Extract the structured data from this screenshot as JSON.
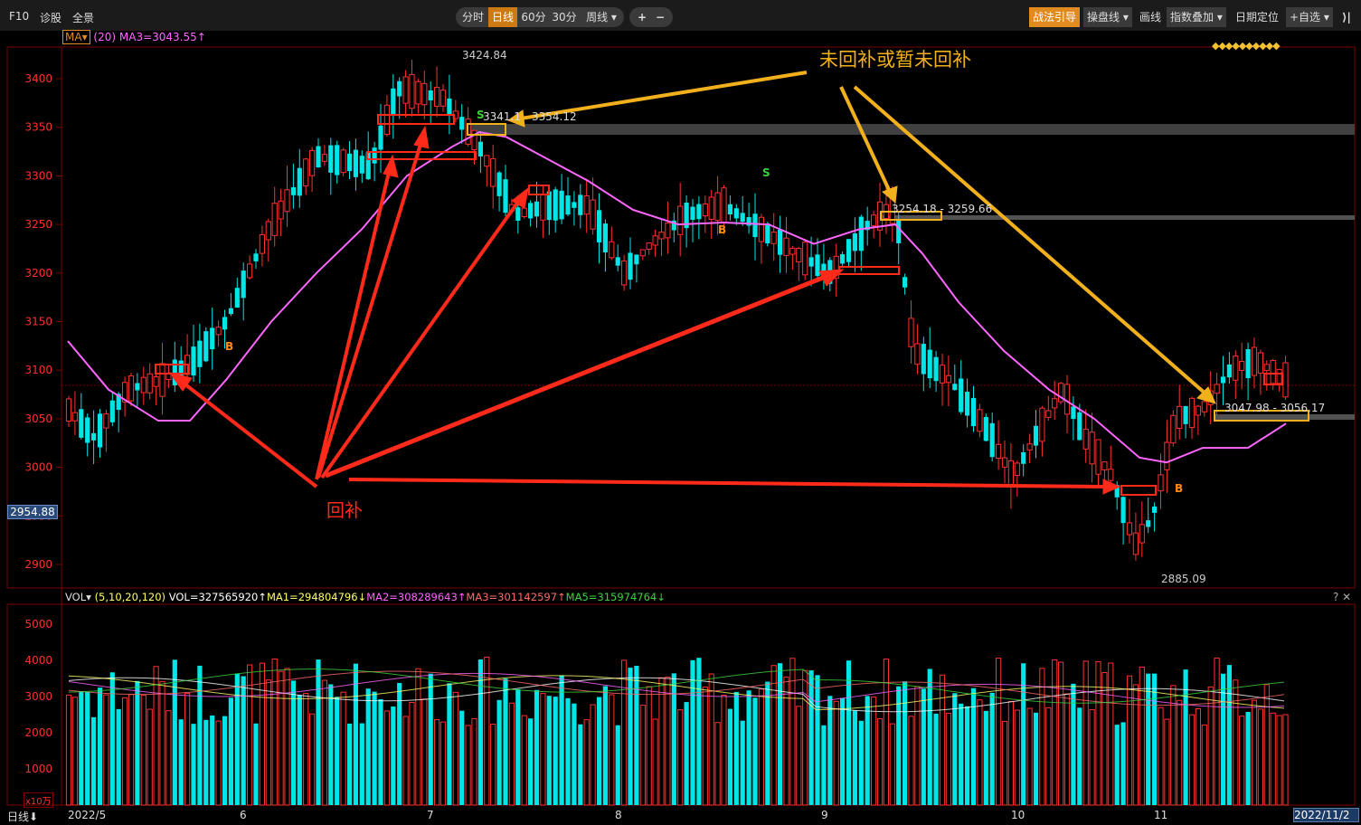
{
  "toolbar": {
    "left": [
      "F10",
      "诊股",
      "全景"
    ],
    "periods": [
      "分时",
      "日线",
      "60分",
      "30分",
      "周线 ▾"
    ],
    "active_period": "日线",
    "zoom_in": "+",
    "zoom_out": "−",
    "right": [
      "战法引导",
      "操盘线 ▾",
      "画线",
      "指数叠加 ▾",
      "日期定位",
      "+自选 ▾"
    ],
    "collapse": "⟩|"
  },
  "main_indicator": {
    "badge": "MA▾",
    "param": "(20)",
    "value": "MA3=3043.55↑",
    "current_price": "2954.88",
    "y_ticks": [
      "3400",
      "3350",
      "3300",
      "3250",
      "3200",
      "3150",
      "3100",
      "3050",
      "3000",
      "2950",
      "2900"
    ]
  },
  "annotations": {
    "high": "3424.84",
    "low": "2885.09",
    "gap1": "3341.1",
    "gap1_end": "3354.12",
    "gap2": "3254.18 - 3259.66",
    "gap3": "3047.98 - 3056.17",
    "title_unfilled": "未回补或暂未回补",
    "title_filled": "回补",
    "sell_marks": [
      "S",
      "S"
    ],
    "buy_marks": [
      "B",
      "B",
      "B"
    ]
  },
  "volume_indicator": {
    "name": "VOL▾",
    "params": "(5,10,20,120)",
    "vol": "VOL=327565920↑",
    "ma1": "MA1=294804796↓",
    "ma2": "MA2=308289643↑",
    "ma3": "MA3=301142597↑",
    "ma5": "MA5=315974764↓",
    "y_ticks": [
      "5000",
      "4000",
      "3000",
      "2000",
      "1000"
    ],
    "unit": "x10万",
    "controls": "? ✕"
  },
  "x_axis": {
    "period_label": "日线",
    "arrow": "⬇",
    "labels": [
      "2022/5",
      "6",
      "7",
      "8",
      "9",
      "10",
      "11"
    ],
    "end_date": "2022/11/2"
  },
  "colors": {
    "up": "#ff3030",
    "down": "#00e5e5",
    "ma": "#ff66ff",
    "arrow_red": "#ff2a1a",
    "arrow_gold": "#f2b01c",
    "axis": "#8b0000"
  }
}
